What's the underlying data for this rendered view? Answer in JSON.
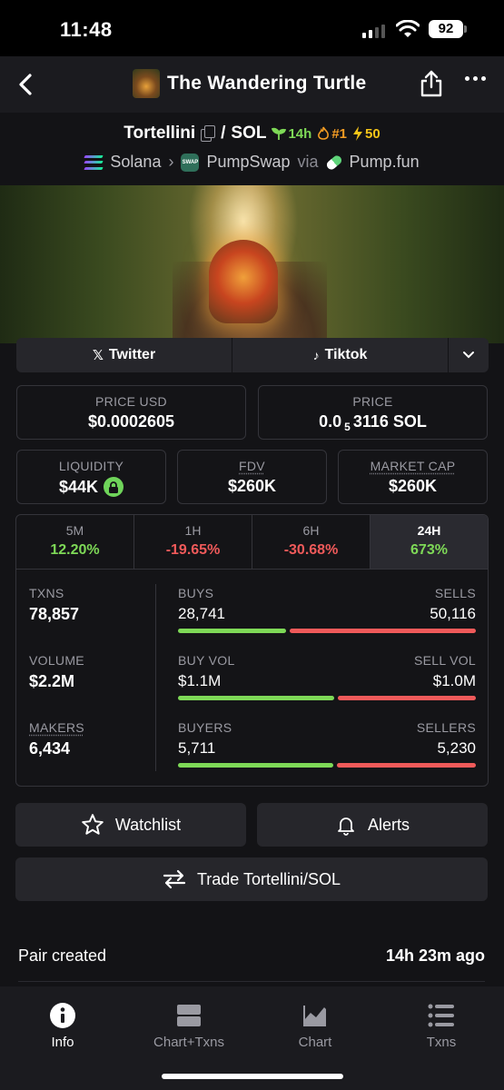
{
  "status_bar": {
    "time": "11:48",
    "battery": "92"
  },
  "nav": {
    "title": "The Wandering Turtle"
  },
  "pair": {
    "base": "Tortellini",
    "quote": "SOL",
    "separator": "/",
    "age_badge": "14h",
    "rank_badge": "#1",
    "boost_badge": "50"
  },
  "chain": {
    "network": "Solana",
    "dex": "PumpSwap",
    "via": "via",
    "launchpad": "Pump.fun"
  },
  "socials": {
    "twitter": "Twitter",
    "tiktok": "Tiktok"
  },
  "metrics": {
    "price_usd_label": "PRICE USD",
    "price_usd": "$0.0002605",
    "price_label": "PRICE",
    "price_prefix": "0.0",
    "price_subscript": "5",
    "price_suffix": "3116 SOL",
    "liquidity_label": "LIQUIDITY",
    "liquidity": "$44K",
    "fdv_label": "FDV",
    "fdv": "$260K",
    "mcap_label": "MARKET CAP",
    "mcap": "$260K"
  },
  "timeframes": [
    {
      "label": "5M",
      "change": "12.20%"
    },
    {
      "label": "1H",
      "change": "-19.65%"
    },
    {
      "label": "6H",
      "change": "-30.68%"
    },
    {
      "label": "24H",
      "change": "673%"
    }
  ],
  "stats": {
    "txns_label": "TXNS",
    "txns": "78,857",
    "volume_label": "VOLUME",
    "volume": "$2.2M",
    "makers_label": "MAKERS",
    "makers": "6,434",
    "buys_label": "BUYS",
    "buys": "28,741",
    "sells_label": "SELLS",
    "sells": "50,116",
    "buy_vol_label": "BUY VOL",
    "buy_vol": "$1.1M",
    "sell_vol_label": "SELL VOL",
    "sell_vol": "$1.0M",
    "buyers_label": "BUYERS",
    "buyers": "5,711",
    "sellers_label": "SELLERS",
    "sellers": "5,230",
    "buys_share": 0.364,
    "buy_vol_share": 0.524,
    "buyers_share": 0.522
  },
  "actions": {
    "watchlist": "Watchlist",
    "alerts": "Alerts",
    "trade": "Trade Tortellini/SOL"
  },
  "pair_created": {
    "label": "Pair created",
    "value": "14h 23m ago"
  },
  "tabs": [
    {
      "label": "Info"
    },
    {
      "label": "Chart+Txns"
    },
    {
      "label": "Chart"
    },
    {
      "label": "Txns"
    }
  ],
  "colors": {
    "positive": "#7ed957",
    "negative": "#f05a5a",
    "background": "#131316"
  }
}
